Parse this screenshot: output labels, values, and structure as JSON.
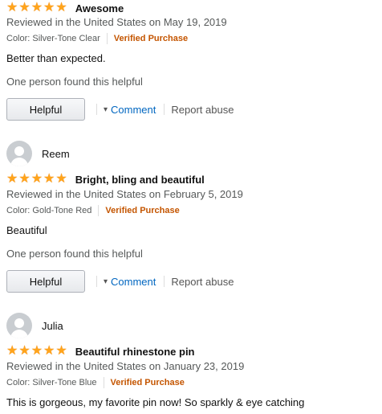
{
  "reviews": [
    {
      "title": "Awesome",
      "date": "Reviewed in the United States on May 19, 2019",
      "color": "Color: Silver-Tone Clear",
      "verified": "Verified Purchase",
      "body": "Better than expected.",
      "helpful_count": "One person found this helpful",
      "helpful_label": "Helpful",
      "comment_label": "Comment",
      "report_label": "Report abuse",
      "rating": 5
    },
    {
      "reviewer": "Reem",
      "title": "Bright, bling and beautiful",
      "date": "Reviewed in the United States on February 5, 2019",
      "color": "Color: Gold-Tone Red",
      "verified": "Verified Purchase",
      "body": "Beautiful",
      "helpful_count": "One person found this helpful",
      "helpful_label": "Helpful",
      "comment_label": "Comment",
      "report_label": "Report abuse",
      "rating": 5
    },
    {
      "reviewer": "Julia",
      "title": "Beautiful rhinestone pin",
      "date": "Reviewed in the United States on January 23, 2019",
      "color": "Color: Silver-Tone Blue",
      "verified": "Verified Purchase",
      "body": "This is gorgeous, my favorite pin now! So sparkly & eye catching",
      "rating": 5
    }
  ],
  "icons": {
    "star": "star-icon",
    "avatar": "default-avatar-icon",
    "chevron": "chevron-down-icon"
  },
  "colors": {
    "star": "#ffa41c",
    "verified": "#c45500",
    "link": "#0066c0",
    "muted": "#565959"
  }
}
